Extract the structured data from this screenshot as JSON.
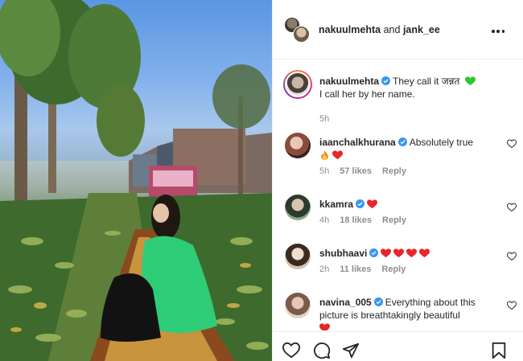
{
  "header": {
    "user1": "nakuulmehta",
    "joiner": "and",
    "user2": "jank_ee",
    "more_icon": "more-horizontal-icon"
  },
  "caption": {
    "username": "nakuulmehta",
    "text_line1": "They call it जन्नत",
    "text_line2": "I call her by her name.",
    "emoji": "green-heart",
    "time": "5h"
  },
  "comments": [
    {
      "username": "iaanchalkhurana",
      "text": "Absolutely true",
      "emojis": [
        "fire",
        "red-heart"
      ],
      "time": "5h",
      "likes": "57 likes",
      "reply": "Reply"
    },
    {
      "username": "kkamra",
      "text": "",
      "emojis": [
        "red-heart"
      ],
      "time": "4h",
      "likes": "18 likes",
      "reply": "Reply"
    },
    {
      "username": "shubhaavi",
      "text": "",
      "emojis": [
        "red-heart",
        "red-heart",
        "red-heart",
        "red-heart"
      ],
      "time": "2h",
      "likes": "11 likes",
      "reply": "Reply"
    },
    {
      "username": "navina_005",
      "text": "Everything about this picture is breathtakingly beautiful",
      "emojis": [
        "red-heart"
      ],
      "time": "",
      "likes": "",
      "reply": ""
    }
  ],
  "actions": [
    "like-icon",
    "comment-icon",
    "share-icon",
    "save-icon"
  ],
  "colors": {
    "verified": "#3897f0",
    "heart_red": "#e8262b",
    "green_heart": "#2cc72c",
    "muted": "#8e8e8e"
  }
}
